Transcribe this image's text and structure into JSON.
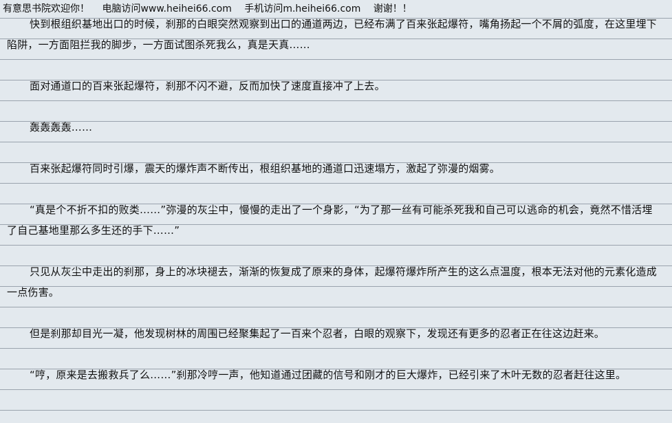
{
  "header": {
    "welcome": "有意思书院欢迎你！",
    "pc_visit": "电脑访问www.heihei66.com",
    "mobile_visit": "手机访问m.heihei66.com",
    "thanks": "谢谢！！"
  },
  "paragraphs": [
    "快到根组织基地出口的时候，刹那的白眼突然观察到出口的通道两边，已经布满了百来张起爆符，嘴角扬起一个不屑的弧度，在这里埋下陷阱，一方面阻拦我的脚步，一方面试图杀死我么，真是天真……",
    "面对通道口的百来张起爆符，刹那不闪不避，反而加快了速度直接冲了上去。",
    "轰轰轰轰……",
    "百来张起爆符同时引爆，震天的爆炸声不断传出，根组织基地的通道口迅速塌方，激起了弥漫的烟雾。",
    "“真是个不折不扣的败类……”弥漫的灰尘中，慢慢的走出了一个身影，“为了那一丝有可能杀死我和自己可以逃命的机会，竟然不惜活埋了自己基地里那么多生还的手下……”",
    "只见从灰尘中走出的刹那，身上的冰块褪去，渐渐的恢复成了原来的身体，起爆符爆炸所产生的这么点温度，根本无法对他的元素化造成一点伤害。",
    "但是刹那却目光一凝，他发现树林的周围已经聚集起了一百来个忍者，白眼的观察下，发现还有更多的忍者正在往这边赶来。",
    "“哼，原来是去搬救兵了么……”刹那冷哼一声，他知道通过团藏的信号和刚才的巨大爆炸，已经引来了木叶无数的忍者赶往这里。"
  ]
}
